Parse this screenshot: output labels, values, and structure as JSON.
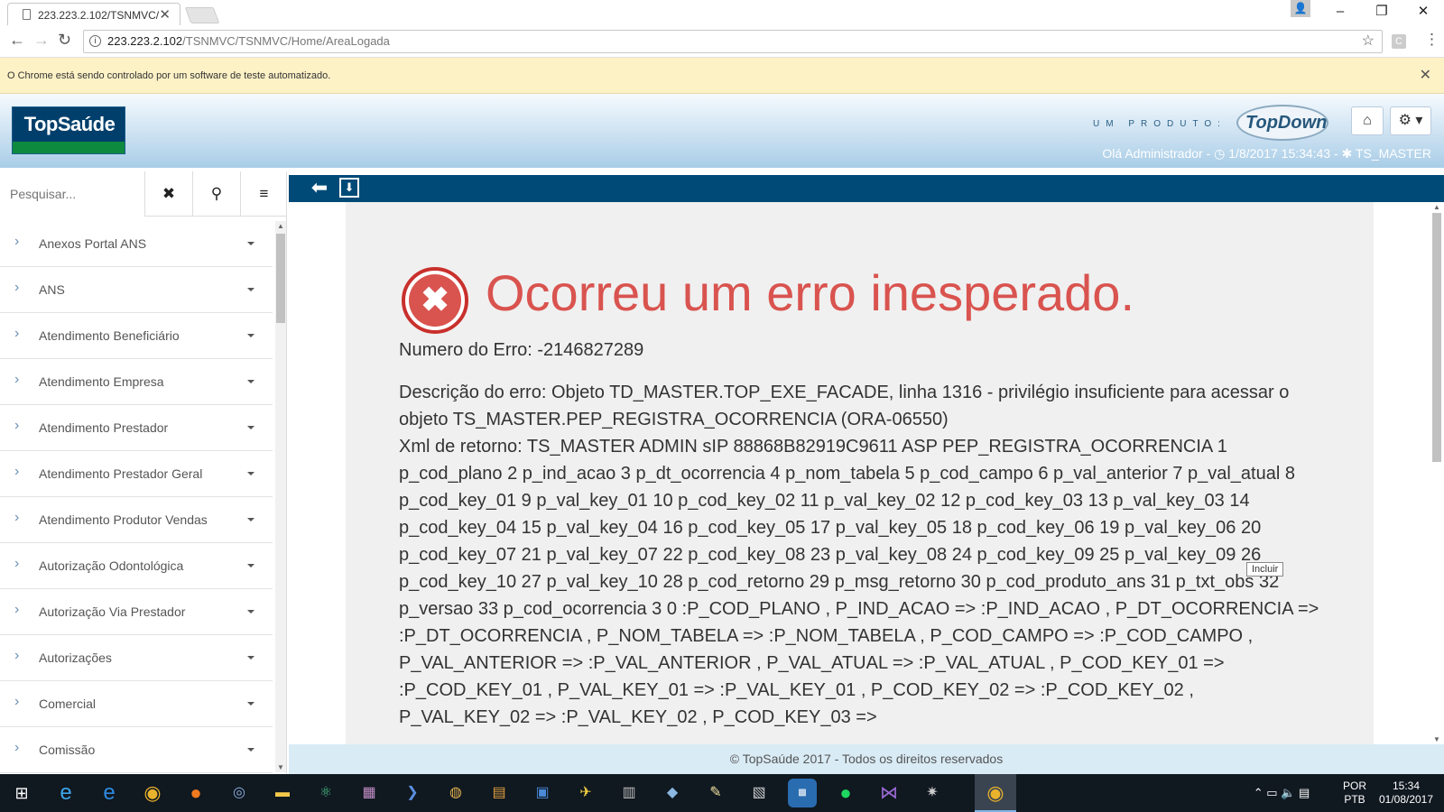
{
  "browser": {
    "tab_title": "223.223.2.102/TSNMVC/",
    "url_host": "223.223.2.102",
    "url_path": "/TSNMVC/TSNMVC/Home/AreaLogada",
    "infobar_text": "O Chrome está sendo controlado por um software de teste automatizado."
  },
  "header": {
    "logo_text": "TopSaúde",
    "produto_label": "UM PRODUTO:",
    "brand": "TopDown",
    "greeting": "Olá Administrador",
    "datetime": "1/8/2017 15:34:43",
    "database": "TS_MASTER"
  },
  "sidebar": {
    "search_placeholder": "Pesquisar...",
    "items": [
      {
        "label": "Anexos Portal ANS"
      },
      {
        "label": "ANS"
      },
      {
        "label": "Atendimento Beneficiário"
      },
      {
        "label": "Atendimento Empresa"
      },
      {
        "label": "Atendimento Prestador"
      },
      {
        "label": "Atendimento Prestador Geral"
      },
      {
        "label": "Atendimento Produtor Vendas"
      },
      {
        "label": "Autorização Odontológica"
      },
      {
        "label": "Autorização Via Prestador"
      },
      {
        "label": "Autorizações"
      },
      {
        "label": "Comercial"
      },
      {
        "label": "Comissão"
      }
    ]
  },
  "error": {
    "title": "Ocorreu um erro inesperado.",
    "number_line": "Numero do Erro: -2146827289",
    "description": "Descrição do erro: Objeto TD_MASTER.TOP_EXE_FACADE, linha 1316 - privilégio insuficiente para acessar o objeto TS_MASTER.PEP_REGISTRA_OCORRENCIA (ORA-06550)",
    "xml": "Xml de retorno: TS_MASTER ADMIN sIP 88868B82919C9611 ASP PEP_REGISTRA_OCORRENCIA 1 p_cod_plano 2 p_ind_acao 3 p_dt_ocorrencia 4 p_nom_tabela 5 p_cod_campo 6 p_val_anterior 7 p_val_atual 8 p_cod_key_01 9 p_val_key_01 10 p_cod_key_02 11 p_val_key_02 12 p_cod_key_03 13 p_val_key_03 14 p_cod_key_04 15 p_val_key_04 16 p_cod_key_05 17 p_val_key_05 18 p_cod_key_06 19 p_val_key_06 20 p_cod_key_07 21 p_val_key_07 22 p_cod_key_08 23 p_val_key_08 24 p_cod_key_09 25 p_val_key_09 26 p_cod_key_10 27 p_val_key_10 28 p_cod_retorno 29 p_msg_retorno 30 p_cod_produto_ans 31 p_txt_obs 32 p_versao 33 p_cod_ocorrencia 3 0 :P_COD_PLANO , P_IND_ACAO => :P_IND_ACAO , P_DT_OCORRENCIA => :P_DT_OCORRENCIA , P_NOM_TABELA => :P_NOM_TABELA , P_COD_CAMPO => :P_COD_CAMPO , P_VAL_ANTERIOR => :P_VAL_ANTERIOR , P_VAL_ATUAL => :P_VAL_ATUAL , P_COD_KEY_01 => :P_COD_KEY_01 , P_VAL_KEY_01 => :P_VAL_KEY_01 , P_COD_KEY_02 => :P_COD_KEY_02 , P_VAL_KEY_02 => :P_VAL_KEY_02 , P_COD_KEY_03 =>",
    "tooltip": "Incluir"
  },
  "footer": {
    "text": "© TopSaúde 2017 - Todos os direitos reservados"
  },
  "taskbar": {
    "lang": "POR",
    "layout": "PTB",
    "time": "15:34",
    "date": "01/08/2017"
  },
  "colors": {
    "toolbar": "#004a77",
    "error_red": "#d9534f",
    "infobar": "#fdf1c6"
  }
}
